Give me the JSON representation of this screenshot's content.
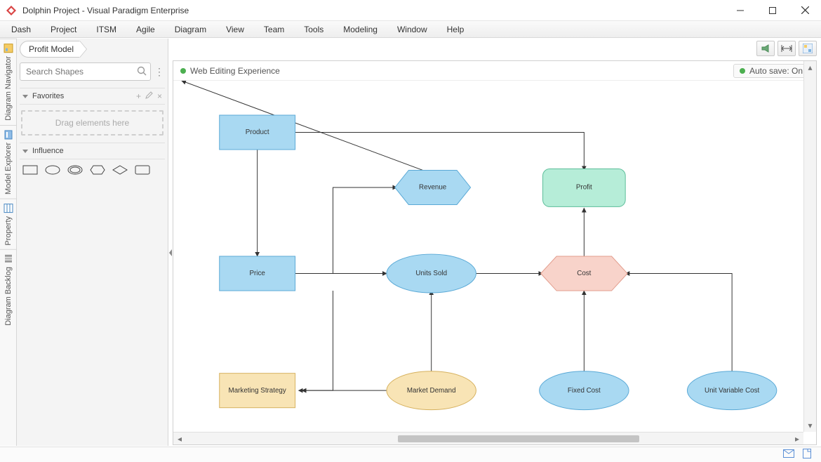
{
  "window": {
    "title": "Dolphin Project - Visual Paradigm Enterprise"
  },
  "menu": {
    "items": [
      "Dash",
      "Project",
      "ITSM",
      "Agile",
      "Diagram",
      "View",
      "Team",
      "Tools",
      "Modeling",
      "Window",
      "Help"
    ]
  },
  "left_tabs": {
    "navigator": "Diagram Navigator",
    "explorer": "Model Explorer",
    "property": "Property",
    "backlog": "Diagram Backlog"
  },
  "sidebar": {
    "breadcrumb": "Profit Model",
    "search_placeholder": "Search Shapes",
    "favorites_label": "Favorites",
    "drag_hint": "Drag elements here",
    "influence_label": "Influence"
  },
  "canvas": {
    "status_left": "Web Editing Experience",
    "autosave": "Auto save: On"
  },
  "diagram": {
    "nodes": {
      "product": "Product",
      "price": "Price",
      "revenue": "Revenue",
      "profit": "Profit",
      "units_sold": "Units Sold",
      "cost": "Cost",
      "marketing": "Marketing Strategy",
      "market_demand": "Market Demand",
      "fixed_cost": "Fixed Cost",
      "unit_var_cost": "Unit Variable Cost"
    }
  },
  "colors": {
    "blue_fill": "#a9d9f2",
    "blue_stroke": "#5aa9d6",
    "mint_fill": "#b6edd8",
    "mint_stroke": "#5bbd99",
    "peach_fill": "#f8d3ca",
    "peach_stroke": "#e29c8c",
    "amber_fill": "#f8e4b5",
    "amber_stroke": "#d6b15e"
  }
}
